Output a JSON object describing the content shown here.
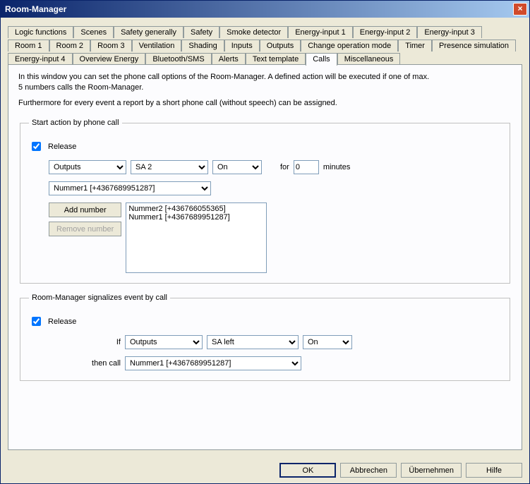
{
  "window": {
    "title": "Room-Manager"
  },
  "tabs": {
    "row1": [
      "Logic functions",
      "Scenes",
      "Safety generally",
      "Safety",
      "Smoke detector",
      "Energy-input 1",
      "Energy-input 2",
      "Energy-input 3"
    ],
    "row2": [
      "Room 1",
      "Room 2",
      "Room 3",
      "Ventilation",
      "Shading",
      "Inputs",
      "Outputs",
      "Change operation mode",
      "Timer",
      "Presence simulation"
    ],
    "row3": [
      "Energy-input 4",
      "Overview Energy",
      "Bluetooth/SMS",
      "Alerts",
      "Text template",
      "Calls",
      "Miscellaneous"
    ],
    "active": "Calls"
  },
  "description_line1": "In this window you can set the phone call options of the Room-Manager. A defined action will be executed if one of max.",
  "description_line2": "5 numbers calls the Room-Manager.",
  "description_line3": "Furthermore for every event a report by a short phone call (without speech) can be assigned.",
  "group1": {
    "legend": "Start action by phone call",
    "release_label": "Release",
    "release_checked": true,
    "target_type": "Outputs",
    "target_channel": "SA 2",
    "target_state": "On",
    "for_label": "for",
    "minutes_value": "0",
    "minutes_label": "minutes",
    "number_select": "Nummer1 [+4367689951287]",
    "add_number_label": "Add number",
    "remove_number_label": "Remove number",
    "numbers_list": [
      "Nummer2 [+436766055365]",
      "Nummer1 [+4367689951287]"
    ]
  },
  "group2": {
    "legend": "Room-Manager signalizes event by call",
    "release_label": "Release",
    "release_checked": true,
    "if_label": "If",
    "cond_type": "Outputs",
    "cond_channel": "SA left",
    "cond_state": "On",
    "then_label": "then call",
    "then_number": "Nummer1 [+4367689951287]"
  },
  "buttons": {
    "ok": "OK",
    "cancel": "Abbrechen",
    "apply": "Übernehmen",
    "help": "Hilfe"
  }
}
